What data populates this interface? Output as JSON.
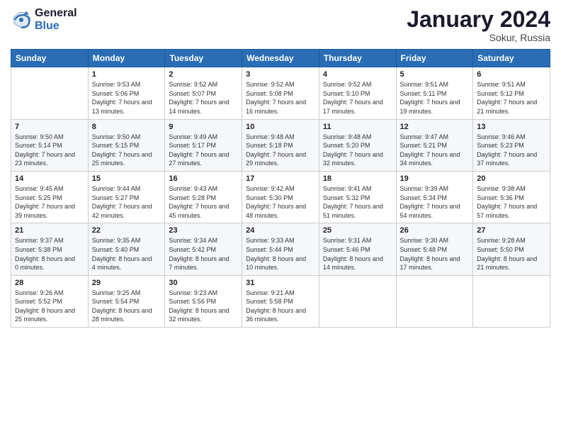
{
  "logo": {
    "line1": "General",
    "line2": "Blue"
  },
  "title": "January 2024",
  "subtitle": "Sokur, Russia",
  "days_header": [
    "Sunday",
    "Monday",
    "Tuesday",
    "Wednesday",
    "Thursday",
    "Friday",
    "Saturday"
  ],
  "weeks": [
    [
      {
        "day": "",
        "sunrise": "",
        "sunset": "",
        "daylight": ""
      },
      {
        "day": "1",
        "sunrise": "Sunrise: 9:53 AM",
        "sunset": "Sunset: 5:06 PM",
        "daylight": "Daylight: 7 hours and 13 minutes."
      },
      {
        "day": "2",
        "sunrise": "Sunrise: 9:52 AM",
        "sunset": "Sunset: 5:07 PM",
        "daylight": "Daylight: 7 hours and 14 minutes."
      },
      {
        "day": "3",
        "sunrise": "Sunrise: 9:52 AM",
        "sunset": "Sunset: 5:08 PM",
        "daylight": "Daylight: 7 hours and 16 minutes."
      },
      {
        "day": "4",
        "sunrise": "Sunrise: 9:52 AM",
        "sunset": "Sunset: 5:10 PM",
        "daylight": "Daylight: 7 hours and 17 minutes."
      },
      {
        "day": "5",
        "sunrise": "Sunrise: 9:51 AM",
        "sunset": "Sunset: 5:11 PM",
        "daylight": "Daylight: 7 hours and 19 minutes."
      },
      {
        "day": "6",
        "sunrise": "Sunrise: 9:51 AM",
        "sunset": "Sunset: 5:12 PM",
        "daylight": "Daylight: 7 hours and 21 minutes."
      }
    ],
    [
      {
        "day": "7",
        "sunrise": "Sunrise: 9:50 AM",
        "sunset": "Sunset: 5:14 PM",
        "daylight": "Daylight: 7 hours and 23 minutes."
      },
      {
        "day": "8",
        "sunrise": "Sunrise: 9:50 AM",
        "sunset": "Sunset: 5:15 PM",
        "daylight": "Daylight: 7 hours and 25 minutes."
      },
      {
        "day": "9",
        "sunrise": "Sunrise: 9:49 AM",
        "sunset": "Sunset: 5:17 PM",
        "daylight": "Daylight: 7 hours and 27 minutes."
      },
      {
        "day": "10",
        "sunrise": "Sunrise: 9:48 AM",
        "sunset": "Sunset: 5:18 PM",
        "daylight": "Daylight: 7 hours and 29 minutes."
      },
      {
        "day": "11",
        "sunrise": "Sunrise: 9:48 AM",
        "sunset": "Sunset: 5:20 PM",
        "daylight": "Daylight: 7 hours and 32 minutes."
      },
      {
        "day": "12",
        "sunrise": "Sunrise: 9:47 AM",
        "sunset": "Sunset: 5:21 PM",
        "daylight": "Daylight: 7 hours and 34 minutes."
      },
      {
        "day": "13",
        "sunrise": "Sunrise: 9:46 AM",
        "sunset": "Sunset: 5:23 PM",
        "daylight": "Daylight: 7 hours and 37 minutes."
      }
    ],
    [
      {
        "day": "14",
        "sunrise": "Sunrise: 9:45 AM",
        "sunset": "Sunset: 5:25 PM",
        "daylight": "Daylight: 7 hours and 39 minutes."
      },
      {
        "day": "15",
        "sunrise": "Sunrise: 9:44 AM",
        "sunset": "Sunset: 5:27 PM",
        "daylight": "Daylight: 7 hours and 42 minutes."
      },
      {
        "day": "16",
        "sunrise": "Sunrise: 9:43 AM",
        "sunset": "Sunset: 5:28 PM",
        "daylight": "Daylight: 7 hours and 45 minutes."
      },
      {
        "day": "17",
        "sunrise": "Sunrise: 9:42 AM",
        "sunset": "Sunset: 5:30 PM",
        "daylight": "Daylight: 7 hours and 48 minutes."
      },
      {
        "day": "18",
        "sunrise": "Sunrise: 9:41 AM",
        "sunset": "Sunset: 5:32 PM",
        "daylight": "Daylight: 7 hours and 51 minutes."
      },
      {
        "day": "19",
        "sunrise": "Sunrise: 9:39 AM",
        "sunset": "Sunset: 5:34 PM",
        "daylight": "Daylight: 7 hours and 54 minutes."
      },
      {
        "day": "20",
        "sunrise": "Sunrise: 9:38 AM",
        "sunset": "Sunset: 5:36 PM",
        "daylight": "Daylight: 7 hours and 57 minutes."
      }
    ],
    [
      {
        "day": "21",
        "sunrise": "Sunrise: 9:37 AM",
        "sunset": "Sunset: 5:38 PM",
        "daylight": "Daylight: 8 hours and 0 minutes."
      },
      {
        "day": "22",
        "sunrise": "Sunrise: 9:35 AM",
        "sunset": "Sunset: 5:40 PM",
        "daylight": "Daylight: 8 hours and 4 minutes."
      },
      {
        "day": "23",
        "sunrise": "Sunrise: 9:34 AM",
        "sunset": "Sunset: 5:42 PM",
        "daylight": "Daylight: 8 hours and 7 minutes."
      },
      {
        "day": "24",
        "sunrise": "Sunrise: 9:33 AM",
        "sunset": "Sunset: 5:44 PM",
        "daylight": "Daylight: 8 hours and 10 minutes."
      },
      {
        "day": "25",
        "sunrise": "Sunrise: 9:31 AM",
        "sunset": "Sunset: 5:46 PM",
        "daylight": "Daylight: 8 hours and 14 minutes."
      },
      {
        "day": "26",
        "sunrise": "Sunrise: 9:30 AM",
        "sunset": "Sunset: 5:48 PM",
        "daylight": "Daylight: 8 hours and 17 minutes."
      },
      {
        "day": "27",
        "sunrise": "Sunrise: 9:28 AM",
        "sunset": "Sunset: 5:50 PM",
        "daylight": "Daylight: 8 hours and 21 minutes."
      }
    ],
    [
      {
        "day": "28",
        "sunrise": "Sunrise: 9:26 AM",
        "sunset": "Sunset: 5:52 PM",
        "daylight": "Daylight: 8 hours and 25 minutes."
      },
      {
        "day": "29",
        "sunrise": "Sunrise: 9:25 AM",
        "sunset": "Sunset: 5:54 PM",
        "daylight": "Daylight: 8 hours and 28 minutes."
      },
      {
        "day": "30",
        "sunrise": "Sunrise: 9:23 AM",
        "sunset": "Sunset: 5:56 PM",
        "daylight": "Daylight: 8 hours and 32 minutes."
      },
      {
        "day": "31",
        "sunrise": "Sunrise: 9:21 AM",
        "sunset": "Sunset: 5:58 PM",
        "daylight": "Daylight: 8 hours and 36 minutes."
      },
      {
        "day": "",
        "sunrise": "",
        "sunset": "",
        "daylight": ""
      },
      {
        "day": "",
        "sunrise": "",
        "sunset": "",
        "daylight": ""
      },
      {
        "day": "",
        "sunrise": "",
        "sunset": "",
        "daylight": ""
      }
    ]
  ]
}
